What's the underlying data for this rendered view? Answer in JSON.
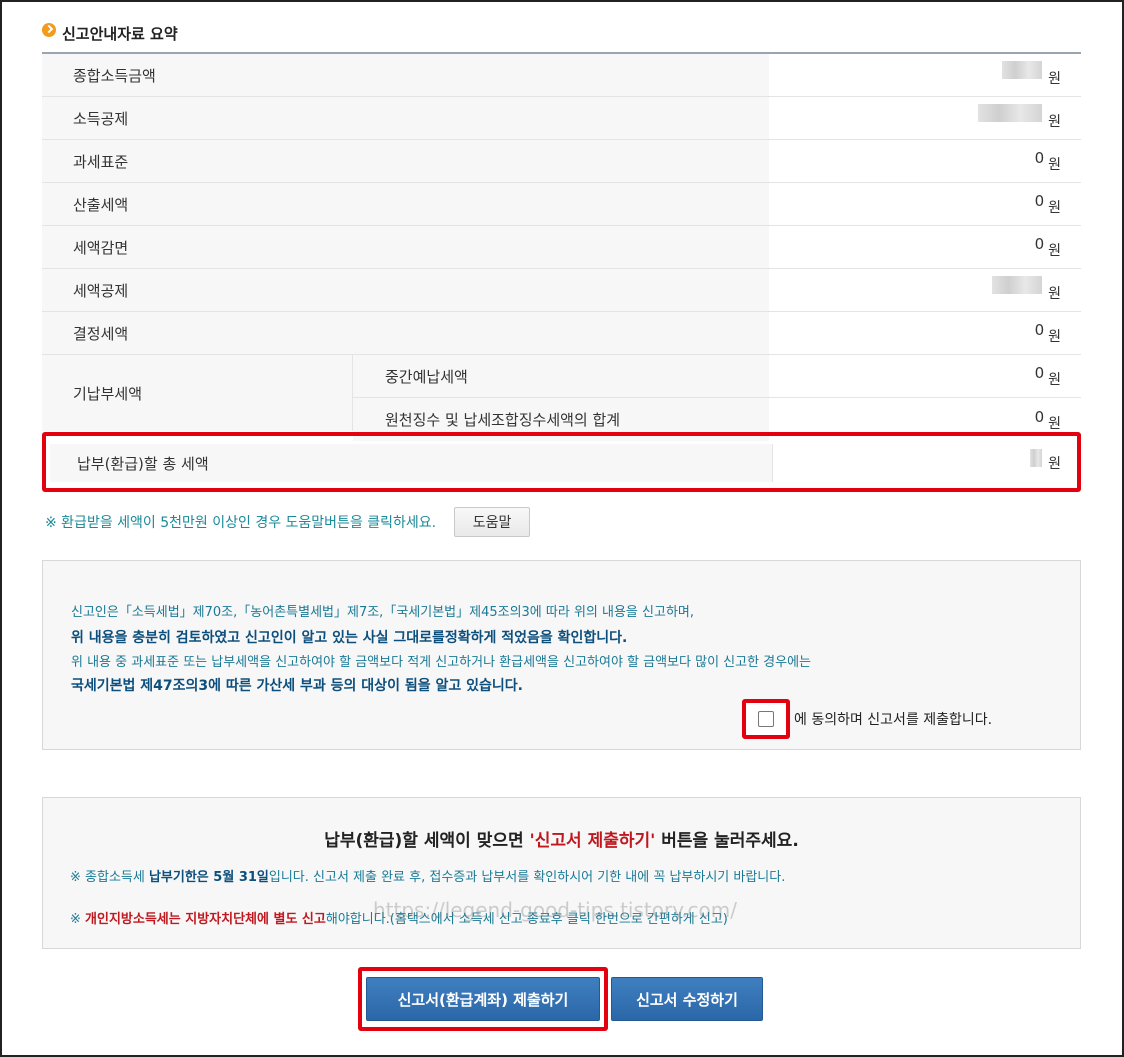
{
  "section": {
    "title": "신고안내자료 요약"
  },
  "summary": {
    "unit": "원",
    "rows": [
      {
        "label": "종합소득금액",
        "value": ""
      },
      {
        "label": "소득공제",
        "value": ""
      },
      {
        "label": "과세표준",
        "value": "0"
      },
      {
        "label": "산출세액",
        "value": "0"
      },
      {
        "label": "세액감면",
        "value": "0"
      },
      {
        "label": "세액공제",
        "value": ""
      },
      {
        "label": "결정세액",
        "value": "0"
      }
    ],
    "prepaid": {
      "label": "기납부세액",
      "items": [
        {
          "label": "중간예납세액",
          "value": "0"
        },
        {
          "label": "원천징수 및 납세조합징수세액의 합계",
          "value": "0"
        }
      ]
    },
    "total": {
      "label": "납부(환급)할 총 세액",
      "value": ""
    }
  },
  "help": {
    "text": "※ 환급받을 세액이 5천만원 이상인 경우 도움말버튼을 클릭하세요.",
    "button": "도움말"
  },
  "declaration": {
    "line1": "신고인은「소득세법」제70조,「농어촌특별세법」제7조,「국세기본법」제45조의3에 따라 위의 내용을 신고하며,",
    "line2": "위 내용을 충분히 검토하였고 신고인이 알고 있는 사실 그대로를정확하게 적었음을 확인합니다.",
    "line3": "위 내용 중 과세표준 또는 납부세액을 신고하여야 할 금액보다 적게 신고하거나 환급세액을 신고하여야 할 금액보다 많이 신고한 경우에는",
    "line4": "국세기본법 제47조의3에 따른 가산세 부과 등의 대상이 됨을 알고 있습니다.",
    "agree": "에 동의하며 신고서를 제출합니다."
  },
  "notice": {
    "head_pre": "납부(환급)할 세액이 맞으면 ",
    "head_red": "'신고서 제출하기'",
    "head_post": " 버튼을 눌러주세요.",
    "l1_pre": "※ 종합소득세 ",
    "l1_bold1": "납부기한은 5월 31일",
    "l1_post": "입니다. 신고서 제출 완료 후, 접수증과 납부서를 확인하시어 기한 내에 꼭 납부하시기 바랍니다.",
    "l2_pre": "※ ",
    "l2_red": "개인지방소득세는 지방자치단체에 별도 신고",
    "l2_post": "해야합니다.(홈택스에서 소득세 신고 종료후 클릭 한번으로 간편하게 신고)",
    "watermark": "https://legend-good-tips.tistory.com/"
  },
  "buttons": {
    "submit": "신고서(환급계좌) 제출하기",
    "edit": "신고서 수정하기"
  }
}
